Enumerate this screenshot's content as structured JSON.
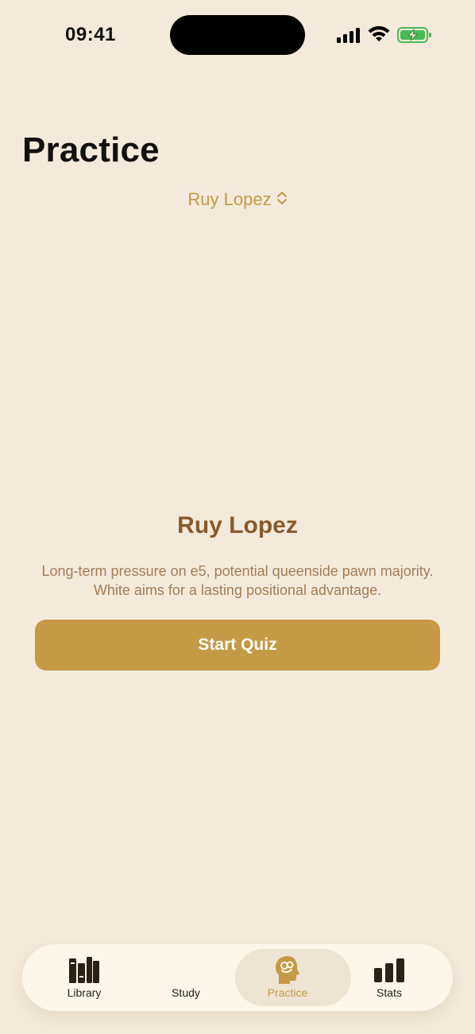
{
  "status_bar": {
    "time": "09:41"
  },
  "page": {
    "title": "Practice"
  },
  "selector": {
    "label": "Ruy Lopez"
  },
  "opening": {
    "name": "Ruy Lopez",
    "description": "Long-term pressure on e5, potential queenside pawn majority. White aims for a lasting positional advantage."
  },
  "actions": {
    "start_label": "Start Quiz"
  },
  "tabbar": {
    "items": [
      {
        "label": "Library",
        "icon": "books-icon"
      },
      {
        "label": "Study",
        "icon": ""
      },
      {
        "label": "Practice",
        "icon": "brain-head-icon",
        "active": true
      },
      {
        "label": "Stats",
        "icon": "bar-chart-icon"
      }
    ]
  },
  "colors": {
    "background": "#F4EADB",
    "accent": "#C49A46",
    "title_brown": "#8A5A2B",
    "tabbar_bg": "#FDF7EB"
  }
}
